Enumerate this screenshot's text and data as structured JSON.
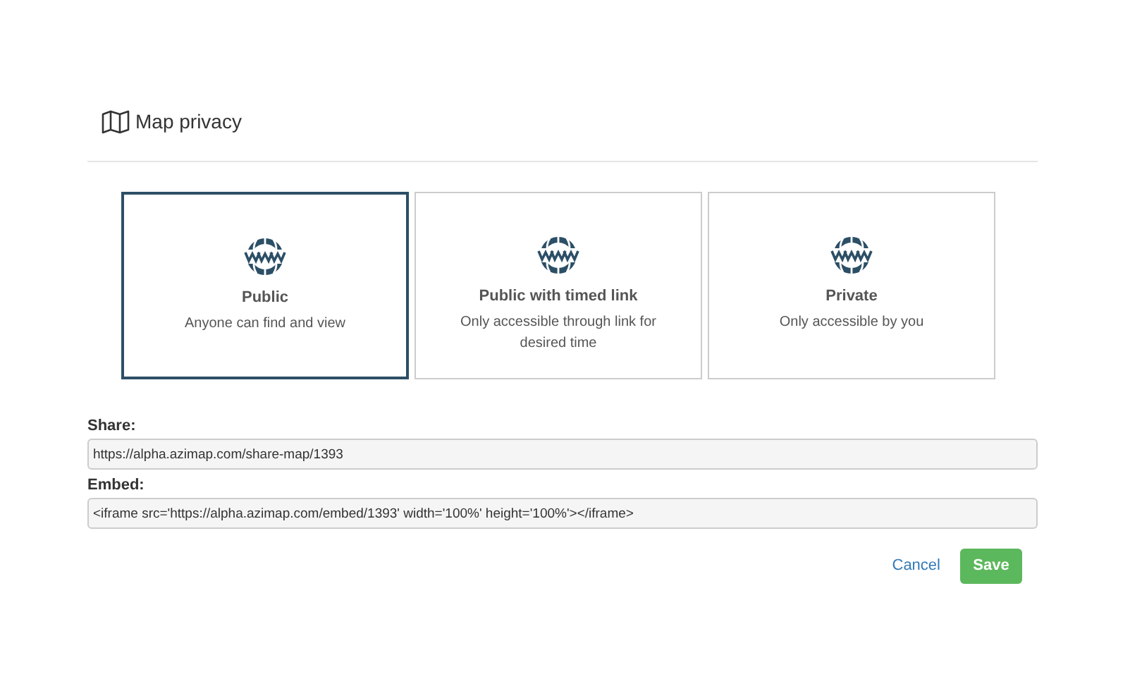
{
  "title": "Map privacy",
  "options": [
    {
      "label": "Public",
      "description": "Anyone can find and view",
      "selected": true
    },
    {
      "label": "Public with timed link",
      "description": "Only accessible through link for desired time",
      "selected": false
    },
    {
      "label": "Private",
      "description": "Only accessible by you",
      "selected": false
    }
  ],
  "fields": [
    {
      "label": "Share:",
      "value": "https://alpha.azimap.com/share-map/1393"
    },
    {
      "label": "Embed:",
      "value": "<iframe src='https://alpha.azimap.com/embed/1393' width='100%' height='100%'></iframe>"
    }
  ],
  "buttons": [
    {
      "kind": "link",
      "label": "Cancel"
    },
    {
      "kind": "primary",
      "label": "Save"
    }
  ]
}
